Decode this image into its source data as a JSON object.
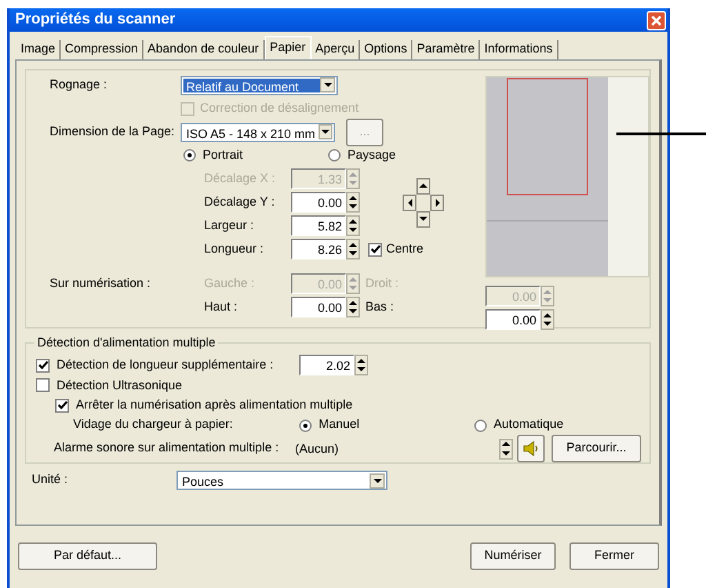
{
  "window": {
    "title": "Propriétés du scanner"
  },
  "tabs": [
    {
      "label": "Image",
      "selected": false
    },
    {
      "label": "Compression",
      "selected": false
    },
    {
      "label": "Abandon de couleur",
      "selected": false
    },
    {
      "label": "Papier",
      "selected": true
    },
    {
      "label": "Aperçu",
      "selected": false
    },
    {
      "label": "Options",
      "selected": false
    },
    {
      "label": "Paramètre",
      "selected": false
    },
    {
      "label": "Informations",
      "selected": false
    }
  ],
  "paper": {
    "crop": {
      "label": "Rognage :",
      "value": "Relatif au Document",
      "focused": true
    },
    "deskew": {
      "label": "Correction de désalignement",
      "checked": false,
      "disabled": true
    },
    "page_size": {
      "label": "Dimension de la Page:",
      "value": "ISO A5 - 148 x 210 mm",
      "button": "..."
    },
    "orientation": [
      {
        "label": "Portrait",
        "selected": true
      },
      {
        "label": "Paysage",
        "selected": false
      }
    ],
    "offsets": [
      {
        "label": "Décalage X :",
        "value": "1.33",
        "disabled": true
      },
      {
        "label": "Décalage Y :",
        "value": "0.00",
        "disabled": false
      },
      {
        "label": "Largeur :",
        "value": "5.82",
        "disabled": false
      }
    ],
    "length": {
      "label": "Longueur :",
      "value": "8.26",
      "disabled": false
    },
    "center": {
      "label": "Centre",
      "checked": true
    },
    "overscan": {
      "label": "Sur numérisation :",
      "fields": [
        {
          "label": "Gauche :",
          "value": "0.00",
          "disabled": true
        },
        {
          "label": "Droit :",
          "value": "0.00",
          "disabled": true
        },
        {
          "label": "Haut :",
          "value": "0.00",
          "disabled": false
        },
        {
          "label": "Bas :",
          "value": "0.00",
          "disabled": false
        }
      ]
    }
  },
  "multifeed": {
    "title": "Détection d'alimentation multiple",
    "length_detection": {
      "label": "Détection de longueur supplémentaire :",
      "checked": true,
      "value": "2.02"
    },
    "ultrasonic": {
      "label": "Détection Ultrasonique",
      "checked": false
    },
    "stop": {
      "label": "Arrêter la numérisation après alimentation multiple",
      "checked": true
    },
    "unload": {
      "label": "Vidage du chargeur à papier:",
      "options": [
        {
          "label": "Manuel",
          "selected": true
        },
        {
          "label": "Automatique",
          "selected": false
        }
      ]
    },
    "alarm": {
      "label": "Alarme sonore sur alimentation multiple :",
      "value": "(Aucun)",
      "button": "Parcourir..."
    }
  },
  "unit": {
    "label": "Unité :",
    "value": "Pouces"
  },
  "buttons": [
    {
      "label": "Par défaut..."
    },
    {
      "label": "Numériser"
    },
    {
      "label": "Fermer"
    }
  ]
}
